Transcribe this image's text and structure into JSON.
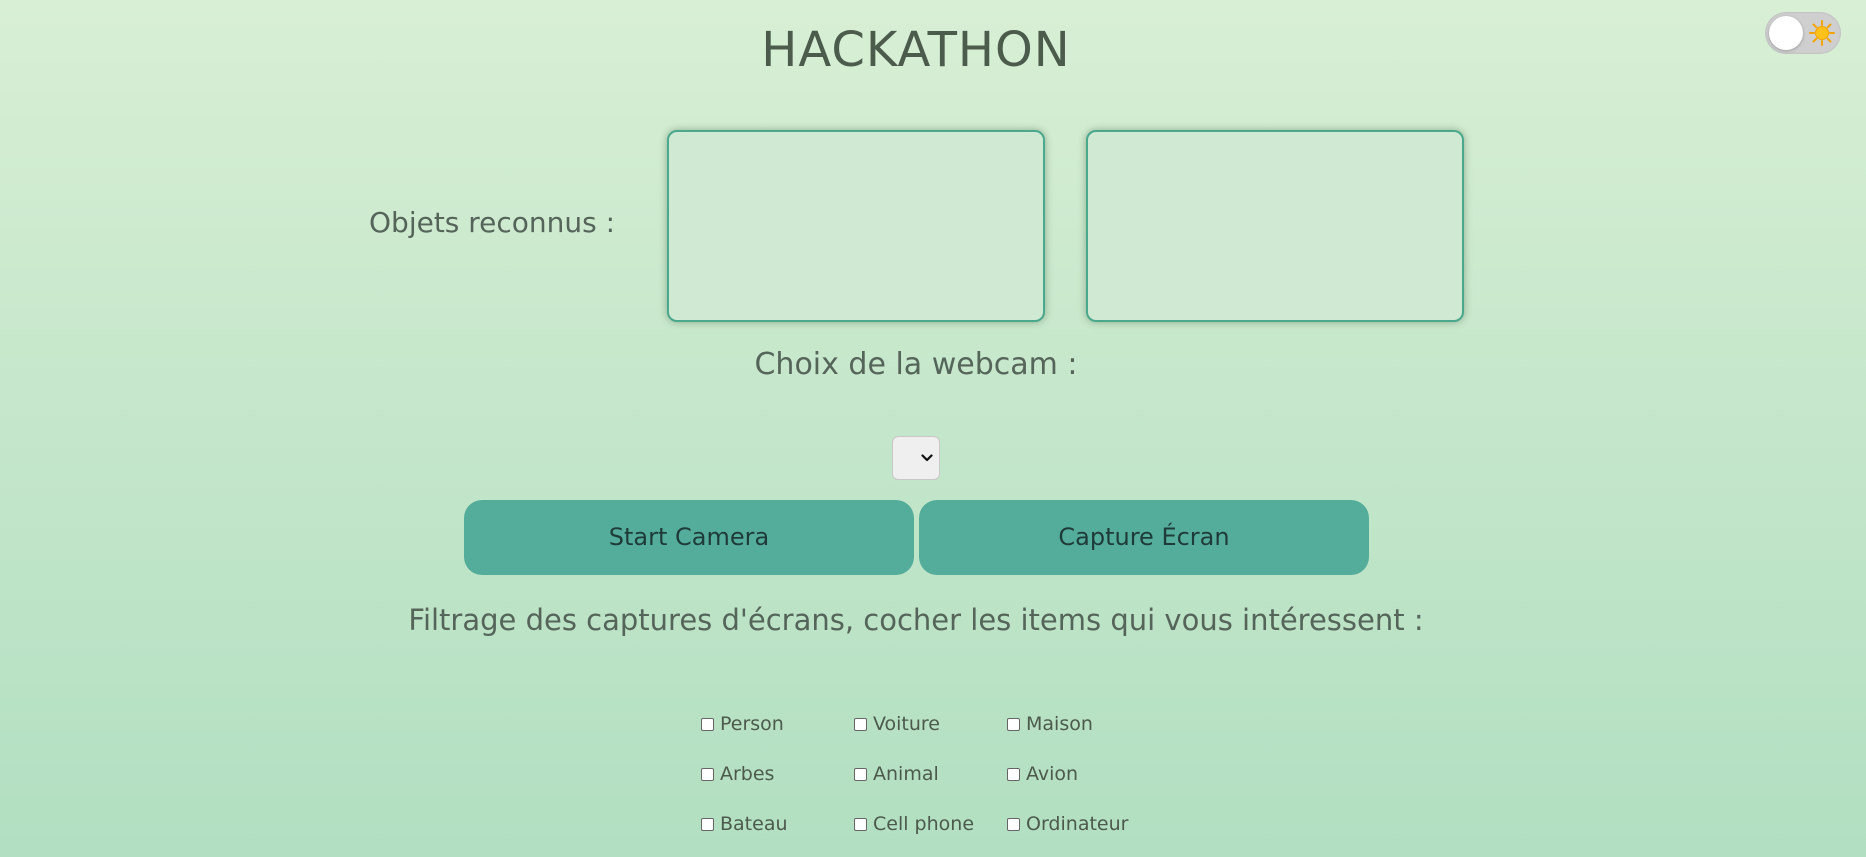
{
  "header": {
    "title": "HACKATHON",
    "theme_toggle": {
      "state": "light",
      "icon": "sun-icon"
    }
  },
  "detection": {
    "label": "Objets reconnus :"
  },
  "webcam": {
    "label": "Choix de la webcam :",
    "selected": ""
  },
  "buttons": {
    "start_camera": "Start Camera",
    "capture_ecran": "Capture Écran"
  },
  "filter": {
    "label": "Filtrage des captures d'écrans, cocher les items qui vous intéressent :",
    "items": [
      {
        "label": "Person",
        "checked": false
      },
      {
        "label": "Voiture",
        "checked": false
      },
      {
        "label": "Maison",
        "checked": false
      },
      {
        "label": "Arbes",
        "checked": false
      },
      {
        "label": "Animal",
        "checked": false
      },
      {
        "label": "Avion",
        "checked": false
      },
      {
        "label": "Bateau",
        "checked": false
      },
      {
        "label": "Cell phone",
        "checked": false
      },
      {
        "label": "Ordinateur",
        "checked": false
      }
    ]
  },
  "colors": {
    "accent": "#54ad9b",
    "box_border": "#4aa88d",
    "text": "#4c5a4c"
  }
}
